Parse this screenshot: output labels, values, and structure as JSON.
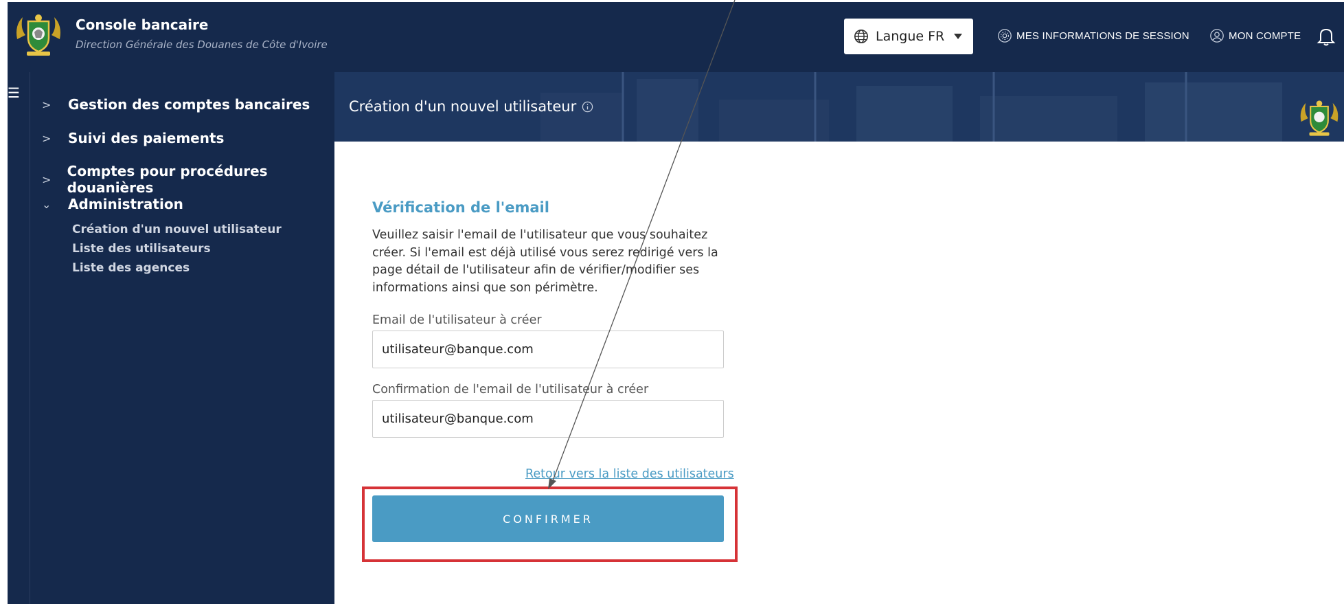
{
  "header": {
    "app_title": "Console bancaire",
    "app_subtitle": "Direction Générale des Douanes de Côte d'Ivoire",
    "language_label": "Langue FR",
    "session_link": "MES INFORMATIONS DE SESSION",
    "account_link": "MON COMPTE"
  },
  "sidebar": {
    "items": [
      {
        "label": "Gestion des comptes bancaires",
        "expanded": false
      },
      {
        "label": "Suivi des paiements",
        "expanded": false
      },
      {
        "label": "Comptes pour procédures douanières",
        "expanded": false
      },
      {
        "label": "Administration",
        "expanded": true
      }
    ],
    "subitems": [
      {
        "label": "Création d'un nouvel utilisateur"
      },
      {
        "label": "Liste des utilisateurs"
      },
      {
        "label": "Liste des agences"
      }
    ]
  },
  "banner": {
    "title": "Création d'un nouvel utilisateur"
  },
  "form": {
    "section_title": "Vérification de l'email",
    "intro": "Veuillez saisir l'email de l'utilisateur que vous souhaitez créer. Si l'email est déjà utilisé vous serez redirigé vers la page détail de l'utilisateur afin de vérifier/modifier ses informations ainsi que son périmètre.",
    "email_label": "Email de l'utilisateur à créer",
    "email_value": "utilisateur@banque.com",
    "confirm_email_label": "Confirmation de l'email de l'utilisateur à créer",
    "confirm_email_value": "utilisateur@banque.com",
    "back_link": "Retour vers la liste des utilisateurs",
    "confirm_button": "CONFIRMER"
  },
  "colors": {
    "navy": "#15294c",
    "accent": "#4a9bc4",
    "highlight": "#d63337"
  }
}
